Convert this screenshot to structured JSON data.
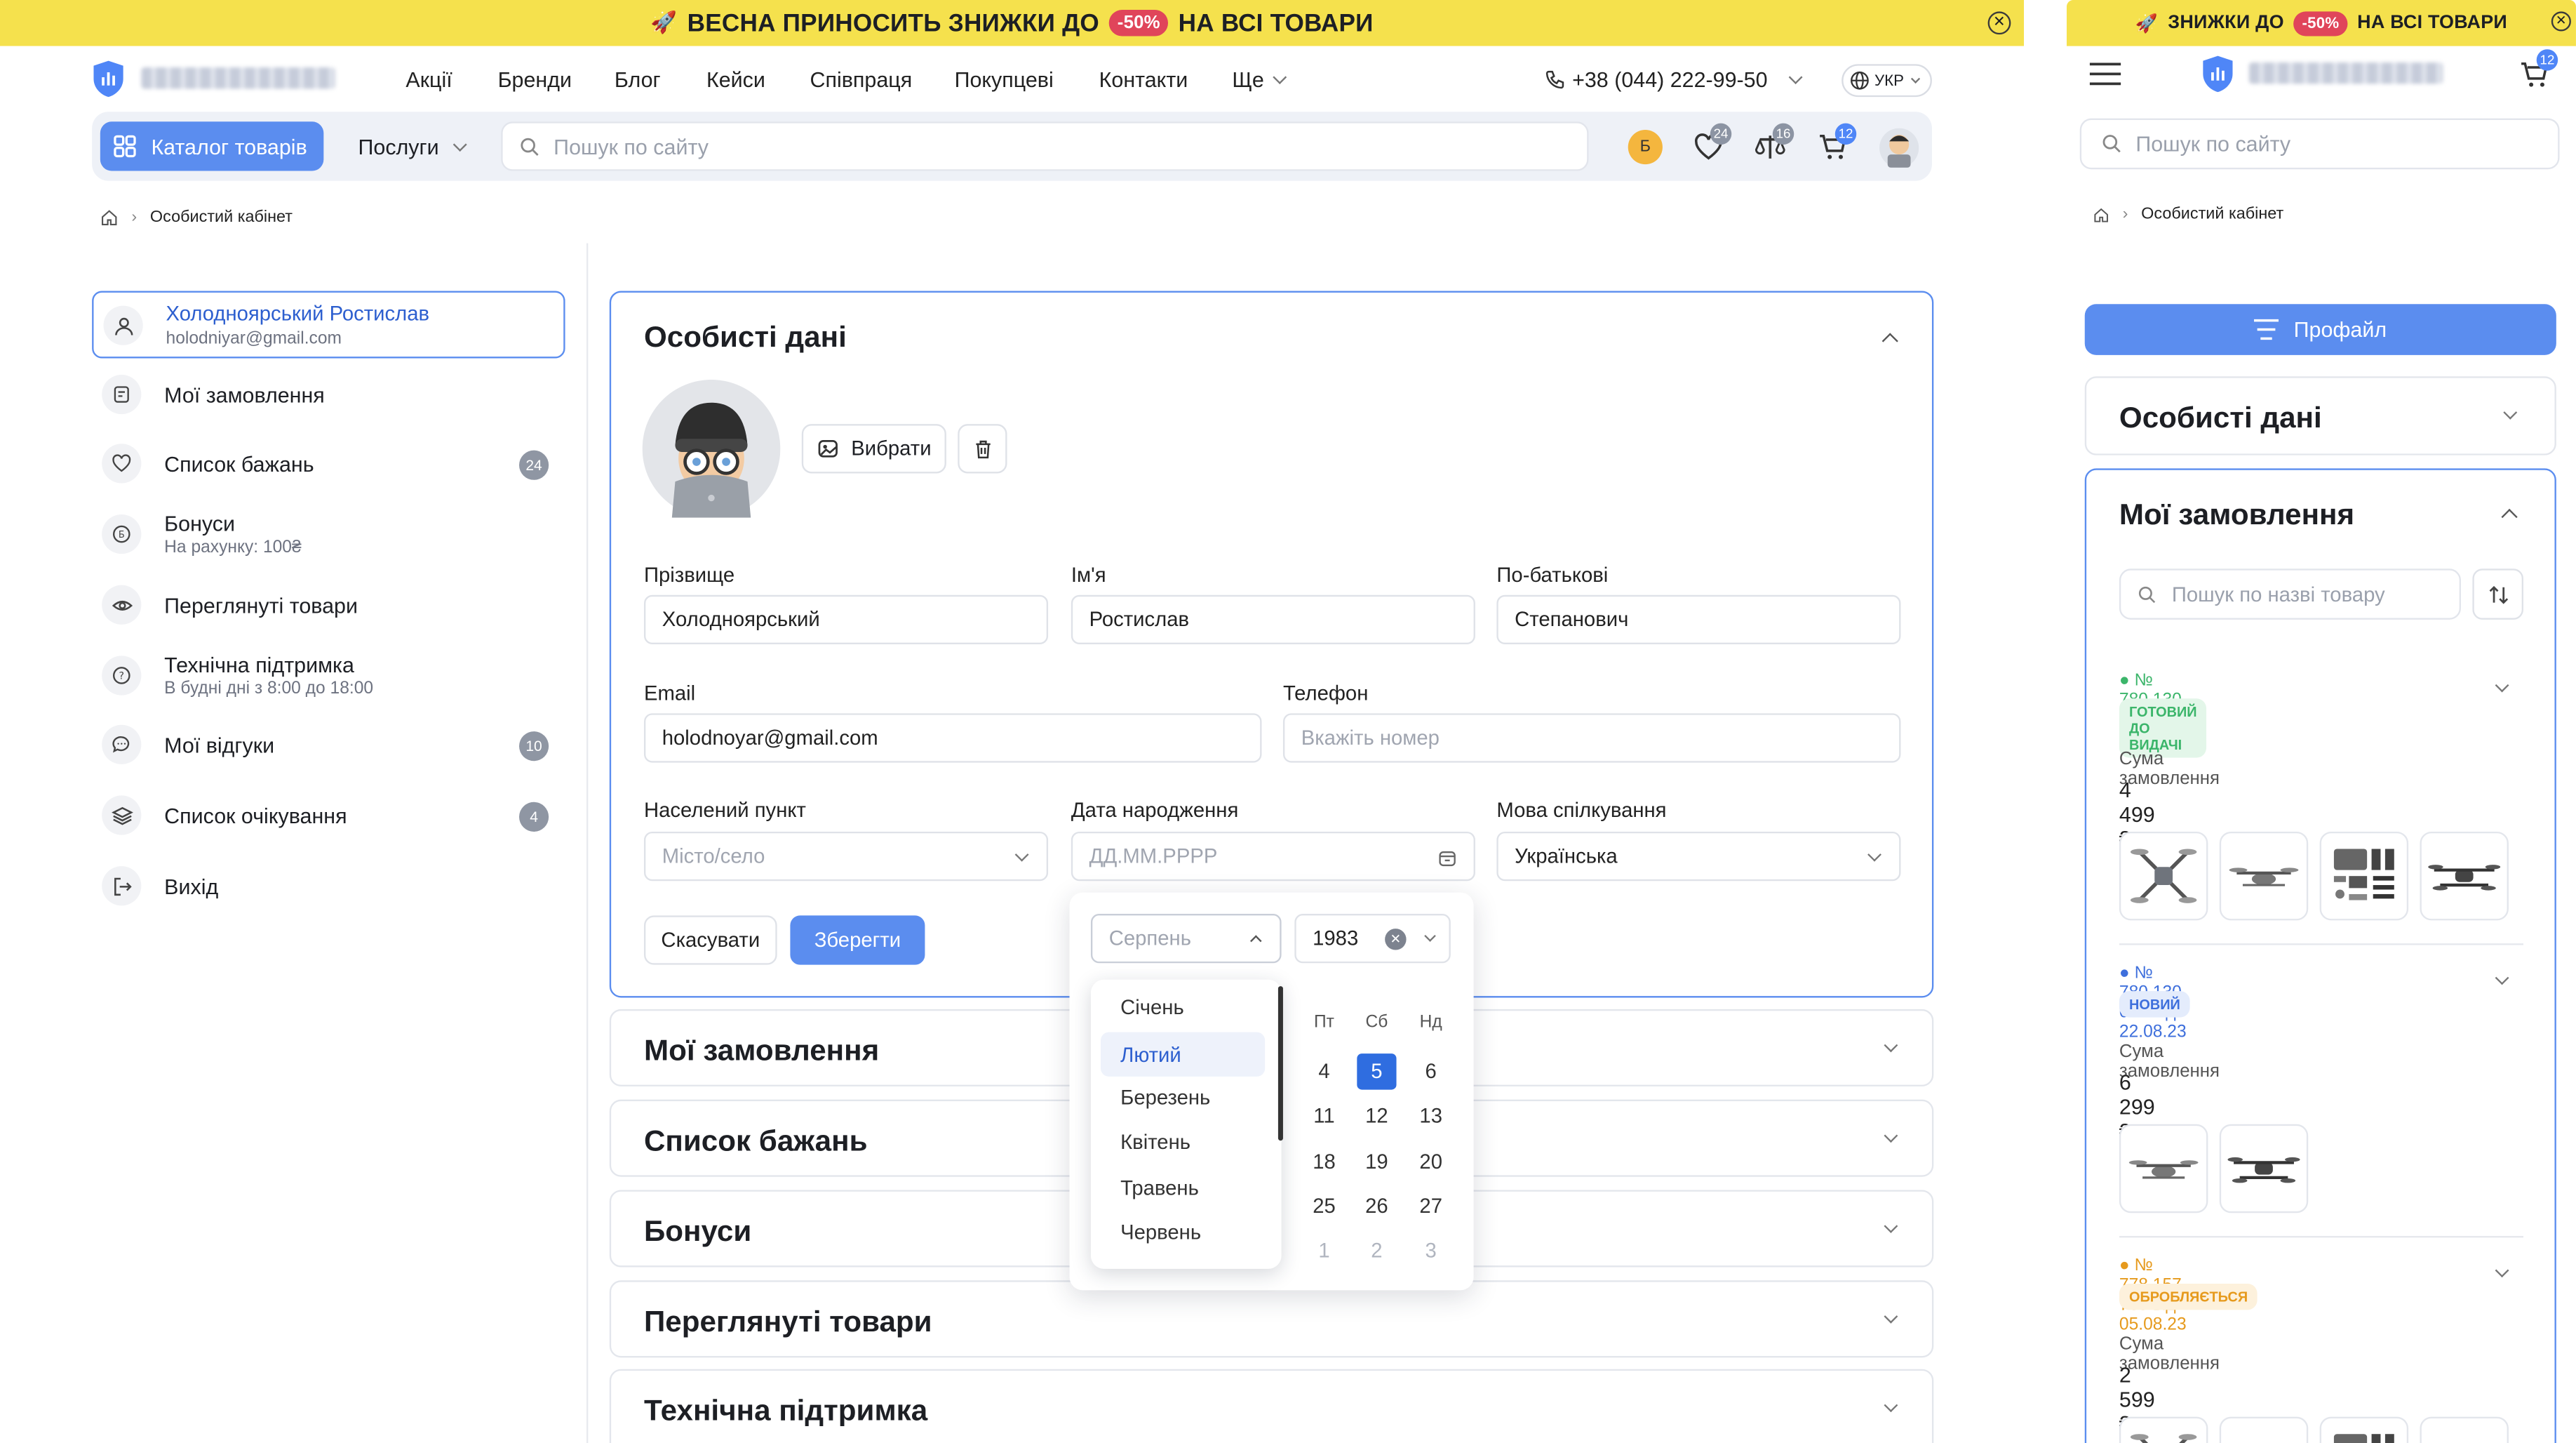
{
  "promo": {
    "desktop_text_1": "ВЕСНА ПРИНОСИТЬ ЗНИЖКИ ДО",
    "discount": "-50%",
    "desktop_text_2": "НА ВСІ ТОВАРИ",
    "mobile_text_1": "ЗНИЖКИ ДО",
    "mobile_text_2": "НА ВСІ ТОВАРИ",
    "bg_color": "#f5e14d",
    "discount_color": "#e0455a"
  },
  "header": {
    "nav": [
      "Акції",
      "Бренди",
      "Блог",
      "Кейси",
      "Співпраця",
      "Покупцеві",
      "Контакти",
      "Ще"
    ],
    "phone": "+38 (044) 222-99-50",
    "language": "УКР"
  },
  "toolbar": {
    "catalog_label": "Каталог товарів",
    "services_label": "Послуги",
    "search_placeholder": "Пошук по сайту",
    "bonus_letter": "Б",
    "wishlist_count": "24",
    "compare_count": "16",
    "cart_count": "12",
    "accent": "#5b8def"
  },
  "breadcrumb": {
    "current": "Особистий кабінет"
  },
  "sidebar": {
    "user_name": "Холодноярський Ростислав",
    "user_email": "holodniyar@gmail.com",
    "items": [
      {
        "label": "Мої замовлення",
        "sub": "",
        "count": ""
      },
      {
        "label": "Список бажань",
        "sub": "",
        "count": "24"
      },
      {
        "label": "Бонуси",
        "sub": "На рахунку: 100₴",
        "count": ""
      },
      {
        "label": "Переглянуті товари",
        "sub": "",
        "count": ""
      },
      {
        "label": "Технічна підтримка",
        "sub": "В будні дні з 8:00 до 18:00",
        "count": ""
      },
      {
        "label": "Мої відгуки",
        "sub": "",
        "count": "10"
      },
      {
        "label": "Список очікування",
        "sub": "",
        "count": "4"
      },
      {
        "label": "Вихід",
        "sub": "",
        "count": ""
      }
    ]
  },
  "personal": {
    "title": "Особисті дані",
    "choose_label": "Вибрати",
    "fields": {
      "last_name_label": "Прізвище",
      "last_name": "Холодноярський",
      "first_name_label": "Ім'я",
      "first_name": "Ростислав",
      "middle_name_label": "По-батькові",
      "middle_name": "Степанович",
      "email_label": "Email",
      "email": "holodnoyar@gmail.com",
      "phone_label": "Телефон",
      "phone_placeholder": "Вкажіть номер",
      "city_label": "Населений пункт",
      "city_placeholder": "Місто/село",
      "birth_label": "Дата народження",
      "birth_placeholder": "ДД.ММ.РРРР",
      "language_label": "Мова спілкування",
      "language": "Українська"
    },
    "cancel_label": "Скасувати",
    "save_label": "Зберегти"
  },
  "datepicker": {
    "month_placeholder": "Серпень",
    "year": "1983",
    "months": [
      "Січень",
      "Лютий",
      "Березень",
      "Квітень",
      "Травень",
      "Червень"
    ],
    "highlighted_month": "Лютий",
    "weekdays": [
      "Пт",
      "Сб",
      "Нд"
    ],
    "rows": [
      [
        "4",
        "5",
        "6"
      ],
      [
        "11",
        "12",
        "13"
      ],
      [
        "18",
        "19",
        "20"
      ],
      [
        "25",
        "26",
        "27"
      ],
      [
        "1",
        "2",
        "3"
      ]
    ],
    "selected_day": "5"
  },
  "sections": [
    "Мої замовлення",
    "Список бажань",
    "Бонуси",
    "Переглянуті товари",
    "Технічна підтримка"
  ],
  "mobile": {
    "cart_count": "12",
    "search_placeholder": "Пошук по сайту",
    "breadcrumb": "Особистий кабінет",
    "profile_button": "Профайл",
    "personal_title": "Особисті дані",
    "orders_title": "Мої замовлення",
    "orders_search_placeholder": "Пошук по назві товару",
    "sum_label": "Сума замовлення",
    "orders": [
      {
        "number": "№ 780 130 009 від 22.08.23",
        "status": "ГОТОВИЙ ДО ВИДАЧІ",
        "sum": "4 499 ₴",
        "color": "#3bb56a",
        "bg": "#e3f6e9"
      },
      {
        "number": "№ 780 130 008 від 22.08.23",
        "status": "НОВИЙ",
        "sum": "6 299 ₴",
        "color": "#3e6fdc",
        "bg": "#e4ecfc"
      },
      {
        "number": "№ 778 157 769 від 05.08.23",
        "status": "ОБРОБЛЯЄТЬСЯ",
        "sum": "2 599 ₴",
        "color": "#e69a1d",
        "bg": "#fdf1dc"
      }
    ],
    "order_thumbs": [
      "drone-fold",
      "drone-quad",
      "drone-kit",
      "drone-wide",
      "drone-quad",
      "drone-wide",
      "drone-fold",
      "drone-quad",
      "drone-kit",
      "drone-wide"
    ]
  }
}
